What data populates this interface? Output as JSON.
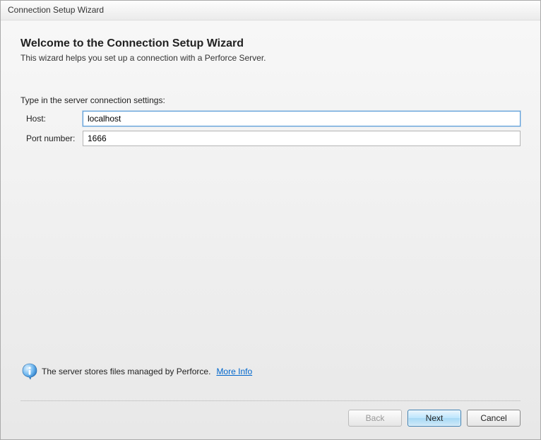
{
  "window": {
    "title": "Connection Setup Wizard"
  },
  "main": {
    "heading": "Welcome to the Connection Setup Wizard",
    "subheading": "This wizard helps you set up a connection with a Perforce Server.",
    "prompt": "Type in the server connection settings:",
    "fields": {
      "host_label": "Host:",
      "host_value": "localhost",
      "port_label": "Port number:",
      "port_value": "1666"
    }
  },
  "info": {
    "text": "The server stores files managed by Perforce.",
    "link_label": "More Info"
  },
  "buttons": {
    "back": "Back",
    "next": "Next",
    "cancel": "Cancel"
  }
}
